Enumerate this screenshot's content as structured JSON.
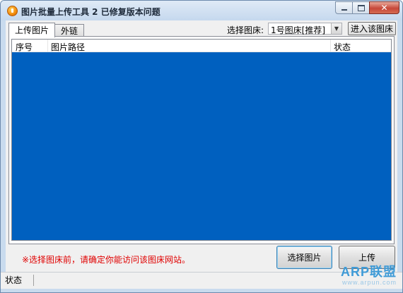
{
  "window": {
    "title": "图片批量上传工具 2 已修复版本问题",
    "close_glyph": "✕"
  },
  "tabs": [
    {
      "label": "上传图片",
      "active": true
    },
    {
      "label": "外链",
      "active": false
    }
  ],
  "host": {
    "label": "选择图床:",
    "selected": "1号图床[推荐]",
    "dropdown_glyph": "▼",
    "enter_button": "进入该图床"
  },
  "list": {
    "columns": [
      "序号",
      "图片路径",
      "状态"
    ],
    "rows": []
  },
  "notice": "※选择图床前，请确定你能访问该图床网站。",
  "buttons": {
    "pick": "选择图片",
    "upload": "上传"
  },
  "statusbar": {
    "label": "状态"
  },
  "watermark": {
    "text": "ARP联盟",
    "url": "www.arpun.com"
  },
  "colors": {
    "list_background": "#0060bf",
    "notice": "#e00000",
    "window_frame": "#c9dbee"
  }
}
